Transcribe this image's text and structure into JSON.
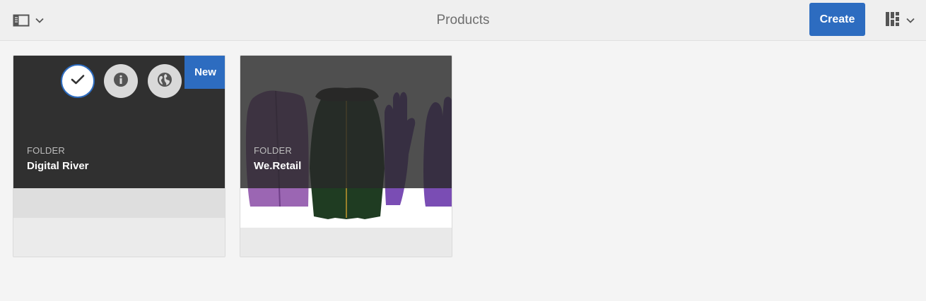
{
  "header": {
    "title": "Products",
    "create_label": "Create",
    "left_icon": "rail-toggle-icon",
    "right_icon": "card-view-icon"
  },
  "colors": {
    "accent": "#2d6cc0",
    "header_bg": "#efefef",
    "page_bg": "#f4f4f4",
    "thumb_dark": "#303030"
  },
  "cards": [
    {
      "type": "FOLDER",
      "title": "Digital River",
      "badge": "New",
      "selected": true,
      "quick_actions": [
        "select-checkmark-icon",
        "info-icon",
        "globe-icon"
      ]
    },
    {
      "type": "FOLDER",
      "title": "We.Retail",
      "thumbnail": "apparel-jackets-gloves"
    }
  ]
}
